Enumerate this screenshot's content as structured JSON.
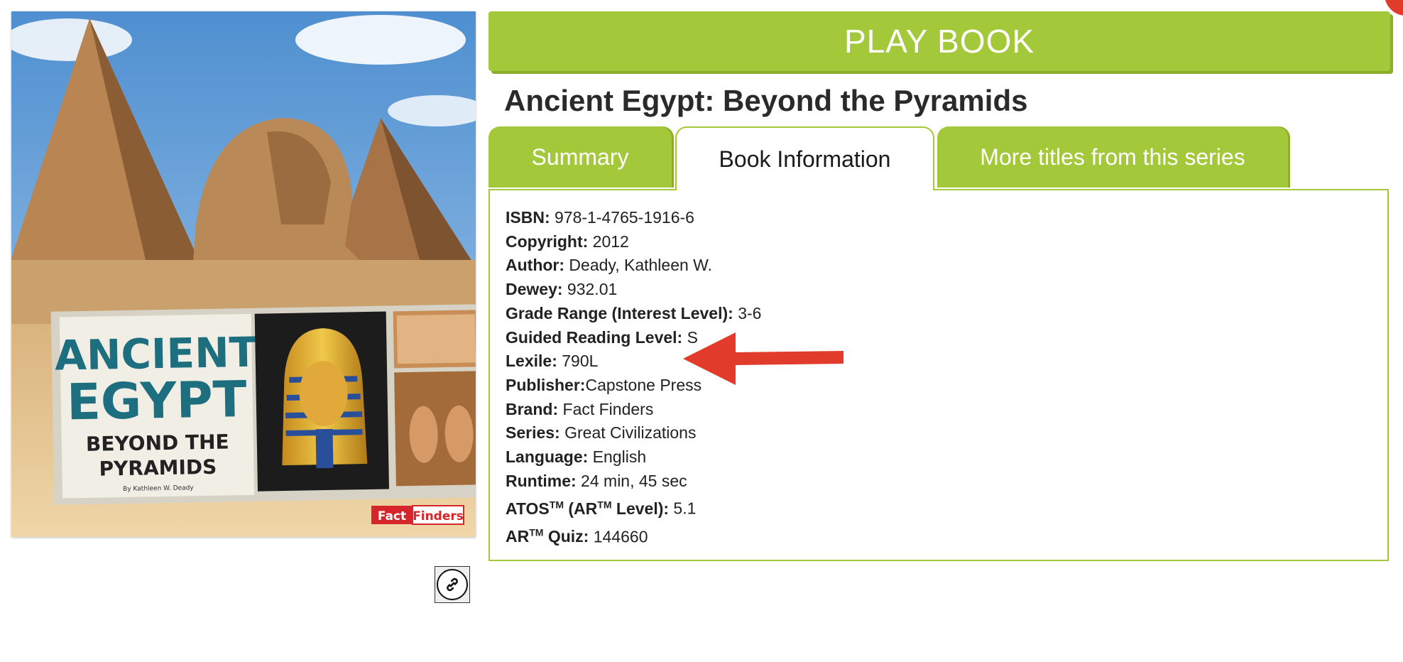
{
  "play_button": {
    "label": "PLAY BOOK"
  },
  "book_title": "Ancient Egypt: Beyond the Pyramids",
  "cover": {
    "title_line1": "ANCIENT",
    "title_line2": "EGYPT",
    "subtitle_line1": "BEYOND THE",
    "subtitle_line2": "PYRAMIDS",
    "byline": "By Kathleen W. Deady",
    "brand_part1": "Fact",
    "brand_part2": "Finders"
  },
  "tabs": [
    {
      "label": "Summary",
      "active": false
    },
    {
      "label": "Book Information",
      "active": true
    },
    {
      "label": "More titles from this series",
      "active": false
    }
  ],
  "book_info": {
    "isbn": {
      "label": "ISBN:",
      "value": " 978-1-4765-1916-6"
    },
    "copyright": {
      "label": "Copyright:",
      "value": " 2012"
    },
    "author": {
      "label": "Author:",
      "value": " Deady, Kathleen W."
    },
    "dewey": {
      "label": "Dewey:",
      "value": " 932.01"
    },
    "grade": {
      "label": "Grade Range (Interest Level):",
      "value": " 3-6"
    },
    "guided": {
      "label": "Guided Reading Level:",
      "value": " S"
    },
    "lexile": {
      "label": "Lexile:",
      "value": " 790L"
    },
    "publisher": {
      "label": "Publisher:",
      "value": "Capstone Press"
    },
    "brand": {
      "label": "Brand:",
      "value": " Fact Finders"
    },
    "series": {
      "label": "Series:",
      "value": " Great Civilizations"
    },
    "language": {
      "label": "Language:",
      "value": " English"
    },
    "runtime": {
      "label": "Runtime:",
      "value": " 24 min, 45 sec"
    },
    "atos": {
      "label_a": "ATOS",
      "tm1": "TM",
      "label_b": " (AR",
      "tm2": "TM",
      "label_c": " Level):",
      "value": " 5.1"
    },
    "ar_quiz": {
      "label_a": "AR",
      "tm": "TM",
      "label_b": " Quiz:",
      "value": " 144660"
    }
  },
  "colors": {
    "accent": "#a3c93a",
    "accent_dark": "#8cac2c",
    "arrow": "#e03b2b",
    "cover_title": "#1d6e7e"
  },
  "icons": {
    "copy_link": "link-icon",
    "annotation": "arrow-left-icon"
  }
}
